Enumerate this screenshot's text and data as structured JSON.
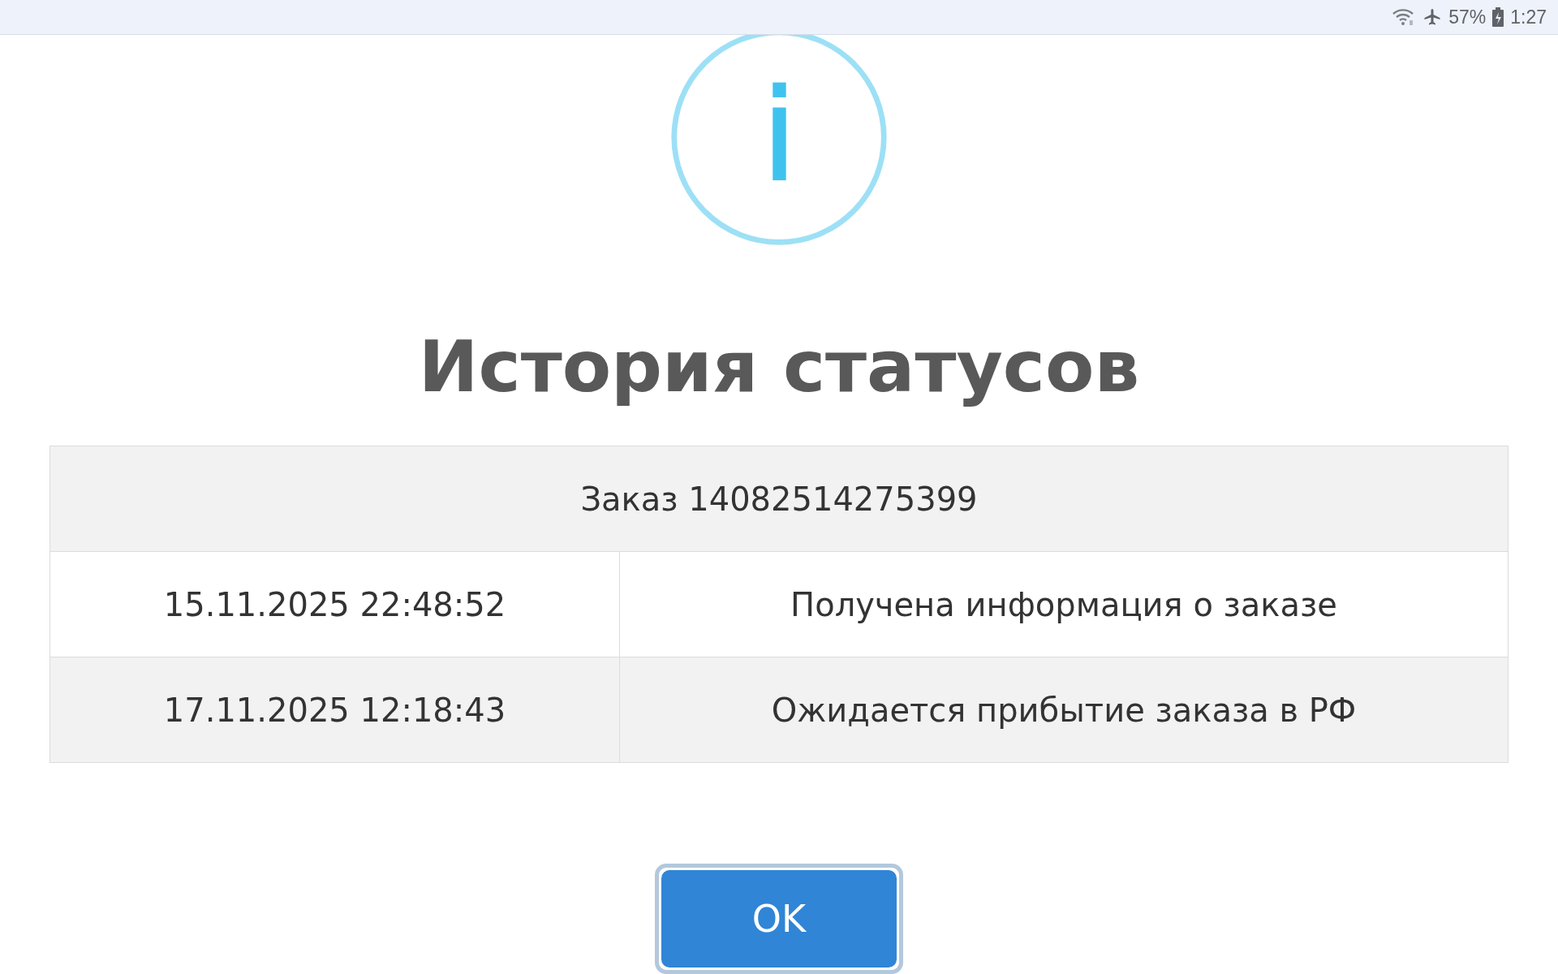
{
  "status_bar": {
    "battery_percent": "57%",
    "time": "1:27"
  },
  "dialog": {
    "title": "История статусов",
    "table": {
      "header": "Заказ 14082514275399",
      "rows": [
        {
          "date": "15.11.2025 22:48:52",
          "status": "Получена информация о заказе"
        },
        {
          "date": "17.11.2025 12:18:43",
          "status": "Ожидается прибытие заказа в РФ"
        }
      ]
    },
    "buttons": [
      "OK"
    ]
  }
}
